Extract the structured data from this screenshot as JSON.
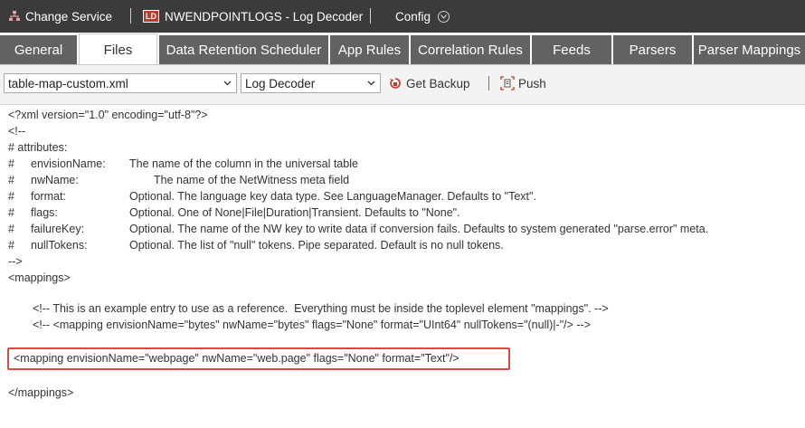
{
  "topbar": {
    "change_service": "Change Service",
    "service_badge": "LD",
    "service_name": "NWENDPOINTLOGS - Log Decoder",
    "config": "Config"
  },
  "tabs": [
    {
      "label": "General"
    },
    {
      "label": "Files"
    },
    {
      "label": "Data Retention Scheduler"
    },
    {
      "label": "App Rules"
    },
    {
      "label": "Correlation Rules"
    },
    {
      "label": "Feeds"
    },
    {
      "label": "Parsers"
    },
    {
      "label": "Parser Mappings"
    }
  ],
  "active_tab": "Files",
  "toolbar": {
    "file_select": "table-map-custom.xml",
    "service_select": "Log Decoder",
    "get_backup": "Get Backup",
    "push": "Push"
  },
  "editor": {
    "lines": {
      "l1": "<?xml version=\"1.0\" encoding=\"utf-8\"?>",
      "l2": "<!--",
      "l3": "# attributes:",
      "l4a": "#",
      "l4b": "envisionName:",
      "l4c": "The name of the column in the universal table",
      "l5a": "#",
      "l5b": "nwName:",
      "l5c": "The name of the NetWitness meta field",
      "l6a": "#",
      "l6b": "format:",
      "l6c": "Optional. The language key data type. See LanguageManager. Defaults to \"Text\".",
      "l7a": "#",
      "l7b": "flags:",
      "l7c": "Optional. One of None|File|Duration|Transient. Defaults to \"None\".",
      "l8a": "#",
      "l8b": "failureKey:",
      "l8c": "Optional. The name of the NW key to write data if conversion fails. Defaults to system generated \"parse.error\" meta.",
      "l9a": "#",
      "l9b": "nullTokens:",
      "l9c": "Optional. The list of \"null\" tokens. Pipe separated. Default is no null tokens.",
      "l10": "-->",
      "l11": "<mappings>",
      "l12": "<!-- This is an example entry to use as a reference.  Everything must be inside the toplevel element \"mappings\". -->",
      "l13": "<!-- <mapping envisionName=\"bytes\" nwName=\"bytes\" flags=\"None\" format=\"UInt64\" nullTokens=\"(null)|-\"/> -->",
      "l14": "<mapping envisionName=\"webpage\" nwName=\"web.page\" flags=\"None\" format=\"Text\"/>",
      "l15": "</mappings>"
    }
  },
  "colors": {
    "topbar_bg": "#3b3b3b",
    "tab_bg": "#626262",
    "highlight_border": "#e04646",
    "badge": "#c0392b"
  }
}
